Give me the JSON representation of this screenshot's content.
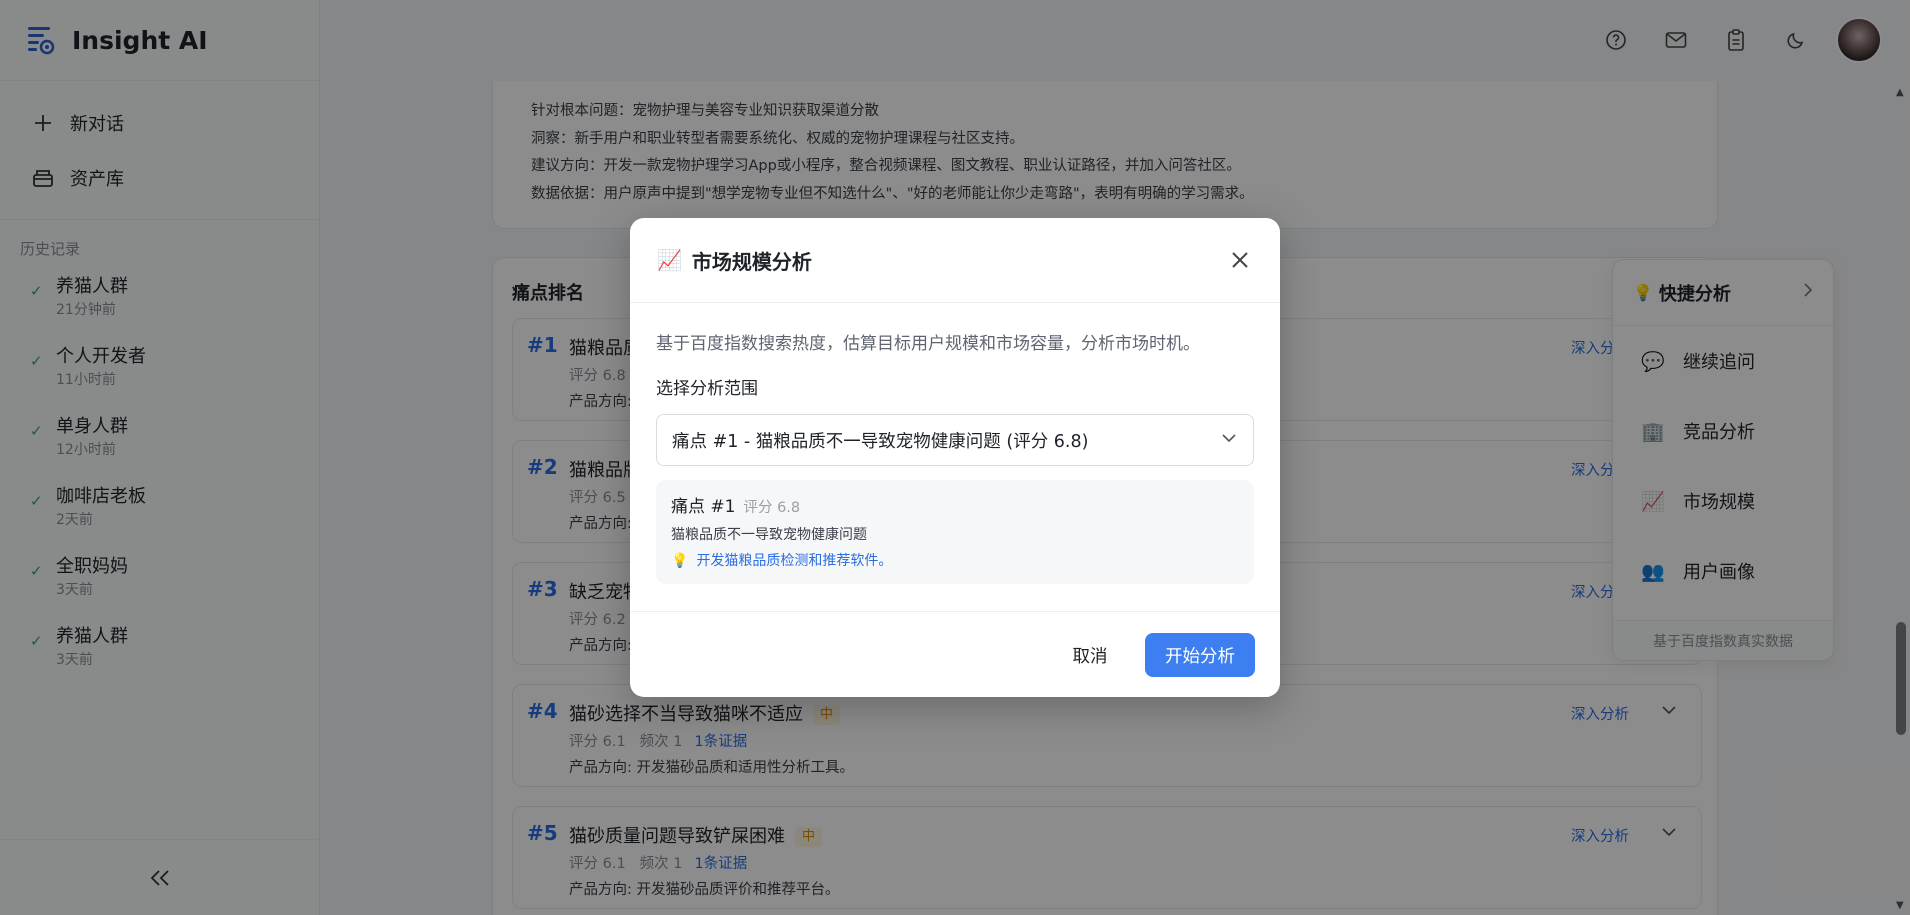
{
  "app": {
    "name": "Insight AI"
  },
  "sidebar": {
    "new_chat": "新对话",
    "library": "资产库",
    "history_title": "历史记录",
    "history": [
      {
        "name": "养猫人群",
        "time": "21分钟前"
      },
      {
        "name": "个人开发者",
        "time": "11小时前"
      },
      {
        "name": "单身人群",
        "time": "12小时前"
      },
      {
        "name": "咖啡店老板",
        "time": "2天前"
      },
      {
        "name": "全职妈妈",
        "time": "3天前"
      },
      {
        "name": "养猫人群",
        "time": "3天前"
      }
    ]
  },
  "insight": {
    "root": "针对根本问题：宠物护理与美容专业知识获取渠道分散",
    "insight": "洞察：新手用户和职业转型者需要系统化、权威的宠物护理课程与社区支持。",
    "suggestion": "建议方向：开发一款宠物护理学习App或小程序，整合视频课程、图文教程、职业认证路径，并加入问答社区。",
    "evidence": "数据依据：用户原声中提到\"想学宠物专业但不知选什么\"、\"好的老师能让你少走弯路\"，表明有明确的学习需求。"
  },
  "ranking": {
    "title": "痛点排名",
    "deep_label": "深入分析",
    "items": [
      {
        "num": "#1",
        "title": "猫粮品质",
        "tag": "",
        "score": "评分 6.8",
        "freq": "",
        "evidence": "",
        "direction": "产品方向:"
      },
      {
        "num": "#2",
        "title": "猫粮品牌",
        "tag": "",
        "score": "评分 6.5",
        "freq": "",
        "evidence": "",
        "direction": "产品方向:"
      },
      {
        "num": "#3",
        "title": "缺乏宠物",
        "tag": "",
        "score": "评分 6.2",
        "freq": "",
        "evidence": "",
        "direction": "产品方向:"
      },
      {
        "num": "#4",
        "title": "猫砂选择不当导致猫咪不适应",
        "tag": "中",
        "score": "评分 6.1",
        "freq": "频次 1",
        "evidence": "1条证据",
        "direction": "产品方向: 开发猫砂品质和适用性分析工具。"
      },
      {
        "num": "#5",
        "title": "猫砂质量问题导致铲屎困难",
        "tag": "中",
        "score": "评分 6.1",
        "freq": "频次 1",
        "evidence": "1条证据",
        "direction": "产品方向: 开发猫砂品质评价和推荐平台。"
      }
    ]
  },
  "quick": {
    "title": "快捷分析",
    "items": [
      {
        "icon": "speech-bubble-icon",
        "label": "继续追问"
      },
      {
        "icon": "building-icon",
        "label": "竞品分析"
      },
      {
        "icon": "chart-icon",
        "label": "市场规模"
      },
      {
        "icon": "users-icon",
        "label": "用户画像"
      }
    ],
    "footer": "基于百度指数真实数据"
  },
  "modal": {
    "title": "市场规模分析",
    "description": "基于百度指数搜索热度，估算目标用户规模和市场容量，分析市场时机。",
    "scope_label": "选择分析范围",
    "selected": "痛点 #1 - 猫粮品质不一导致宠物健康问题 (评分 6.8)",
    "preview": {
      "name": "痛点 #1",
      "score": "评分 6.8",
      "desc": "猫粮品质不一导致宠物健康问题",
      "idea": "开发猫粮品质检测和推荐软件。"
    },
    "cancel": "取消",
    "start": "开始分析"
  },
  "colors": {
    "accent": "#3d7ff0",
    "link": "#2b6de3",
    "success": "#3aa672",
    "tag_bg": "#fff6e0"
  }
}
